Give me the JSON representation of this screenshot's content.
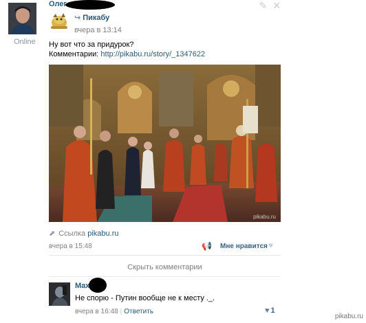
{
  "author": {
    "name": "Олег",
    "status": "Online"
  },
  "repost": {
    "group_name": "Пикабу",
    "date": "вчера в 13:14"
  },
  "post": {
    "line1": "Ну вот что за придурок?",
    "comments_prefix": "Комментарии: ",
    "comments_link": "http://pikabu.ru/story/_1347622"
  },
  "photo": {
    "label": "pikabu.ru"
  },
  "link": {
    "prefix": "Ссылка ",
    "domain": "pikabu.ru"
  },
  "meta": {
    "date": "вчера в 15:48",
    "like_label": "Мне нравится"
  },
  "comments": {
    "hide_label": "Скрыть комментарии",
    "items": [
      {
        "author": "Max",
        "text": "Не спорю - Путин вообще не к месту ._.",
        "date": "вчера в 16:48",
        "reply_label": "Ответить",
        "likes": "1"
      }
    ]
  },
  "watermark": "pikabu.ru",
  "colors": {
    "link": "#2b587a",
    "muted": "#808080",
    "divider": "#e7eaed"
  }
}
